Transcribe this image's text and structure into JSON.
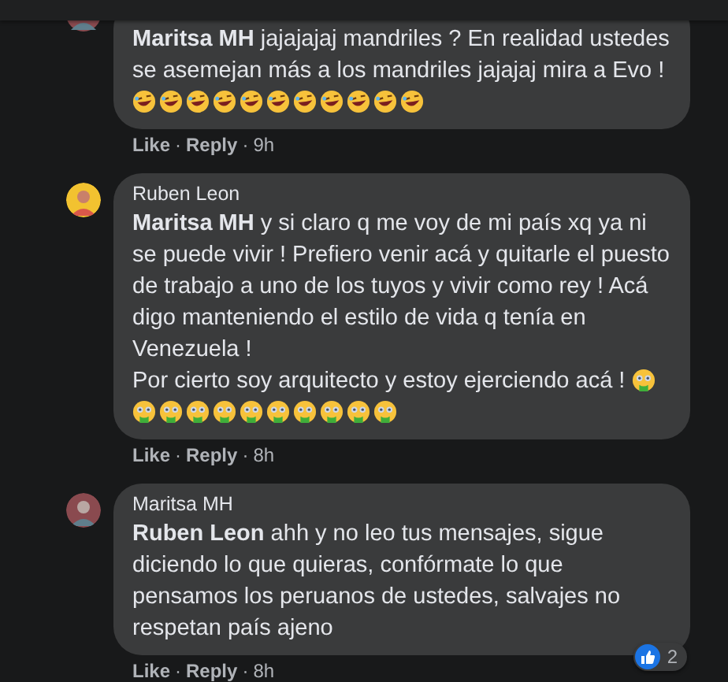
{
  "separator": "·",
  "comments": [
    {
      "mention": "Maritsa MH",
      "text": " jajajajaj mandriles ? En realidad ustedes se asemejan más a los mandriles jajajaj mira a Evo ! ",
      "emojis": [
        {
          "kind": "rofl"
        },
        {
          "kind": "rofl"
        },
        {
          "kind": "rofl"
        },
        {
          "kind": "rofl"
        },
        {
          "kind": "rofl"
        },
        {
          "kind": "rofl"
        },
        {
          "kind": "rofl"
        },
        {
          "kind": "rofl"
        },
        {
          "kind": "rofl"
        },
        {
          "kind": "rofl"
        },
        {
          "kind": "rofl"
        }
      ],
      "actions": [
        "Like",
        "Reply"
      ],
      "time": "9h",
      "avatar": {
        "kind": "picture"
      }
    },
    {
      "author": "Ruben Leon",
      "mention": "Maritsa MH",
      "text": " y si claro q me voy de mi país xq ya ni se puede vivir ! Prefiero venir acá y quitarle el puesto de trabajo a uno de los tuyos y vivir como rey ! Acá digo manteniendo el estilo de vida q tenía en Venezuela !\nPor cierto soy arquitecto y estoy ejerciendo acá ! ",
      "emojis": [
        {
          "kind": "drool"
        },
        {
          "kind": "drool"
        },
        {
          "kind": "drool"
        },
        {
          "kind": "drool"
        },
        {
          "kind": "drool"
        },
        {
          "kind": "drool"
        },
        {
          "kind": "drool"
        },
        {
          "kind": "drool"
        },
        {
          "kind": "drool"
        },
        {
          "kind": "drool"
        },
        {
          "kind": "drool"
        }
      ],
      "actions": [
        "Like",
        "Reply"
      ],
      "time": "8h",
      "avatar": {
        "kind": "picture"
      }
    },
    {
      "author": "Maritsa MH",
      "mention": "Ruben Leon",
      "text": " ahh y no leo tus mensajes, sigue diciendo lo que quieras, confórmate lo que pensamos los peruanos de ustedes, salvajes no respetan país ajeno",
      "actions": [
        "Like",
        "Reply"
      ],
      "time": "8h",
      "avatar": {
        "kind": "picture"
      },
      "reactions": {
        "count": "2"
      }
    }
  ]
}
